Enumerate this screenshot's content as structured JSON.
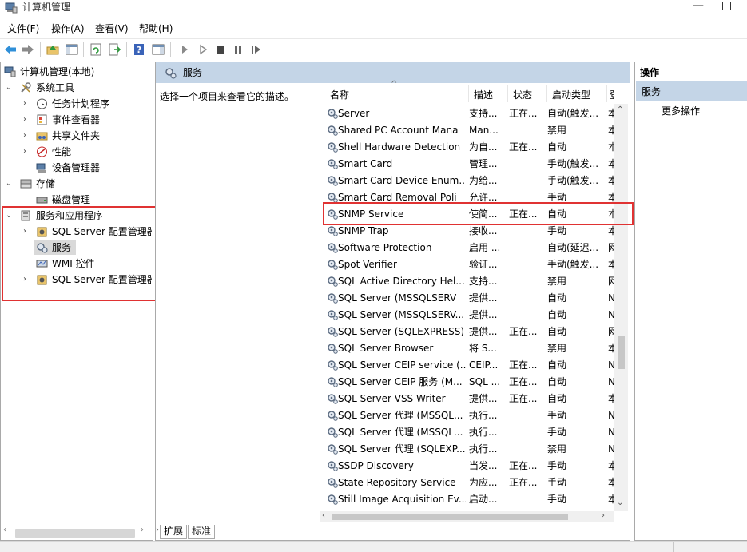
{
  "window": {
    "title": "计算机管理"
  },
  "menu": [
    "文件(F)",
    "操作(A)",
    "查看(V)",
    "帮助(H)"
  ],
  "toolbar_icons": [
    "back-icon",
    "forward-icon",
    "up-folder-icon",
    "show-hide-tree-icon",
    "refresh-icon",
    "export-list-icon",
    "help-icon",
    "show-action-pane-icon",
    "start-service-icon",
    "start-service-alt-icon",
    "stop-service-icon",
    "pause-service-icon",
    "restart-service-icon"
  ],
  "tree": {
    "root": "计算机管理(本地)",
    "system_tools": "系统工具",
    "task_scheduler": "任务计划程序",
    "event_viewer": "事件查看器",
    "shared_folders": "共享文件夹",
    "performance": "性能",
    "device_manager": "设备管理器",
    "storage": "存储",
    "disk_management": "磁盘管理",
    "services_apps": "服务和应用程序",
    "sql_config_1": "SQL Server 配置管理器",
    "services": "服务",
    "wmi": "WMI 控件",
    "sql_config_2": "SQL Server 配置管理器"
  },
  "center": {
    "header_title": "服务",
    "description": "选择一个项目来查看它的描述。",
    "columns": [
      "名称",
      "描述",
      "状态",
      "启动类型",
      "登"
    ],
    "rows": [
      {
        "name": "Server",
        "desc": "支持...",
        "status": "正在...",
        "startup": "自动(触发...",
        "logon": "本"
      },
      {
        "name": "Shared PC Account Mana",
        "desc": "Man...",
        "status": "",
        "startup": "禁用",
        "logon": "本"
      },
      {
        "name": "Shell Hardware Detection",
        "desc": "为自...",
        "status": "正在...",
        "startup": "自动",
        "logon": "本"
      },
      {
        "name": "Smart Card",
        "desc": "管理...",
        "status": "",
        "startup": "手动(触发...",
        "logon": "本"
      },
      {
        "name": "Smart Card Device Enum...",
        "desc": "为给...",
        "status": "",
        "startup": "手动(触发...",
        "logon": "本"
      },
      {
        "name": "Smart Card Removal Poli",
        "desc": "允许...",
        "status": "",
        "startup": "手动",
        "logon": "本"
      },
      {
        "name": "SNMP Service",
        "desc": "使简...",
        "status": "正在...",
        "startup": "自动",
        "logon": "本"
      },
      {
        "name": "SNMP Trap",
        "desc": "接收...",
        "status": "",
        "startup": "手动",
        "logon": "本"
      },
      {
        "name": "Software Protection",
        "desc": "启用 ...",
        "status": "",
        "startup": "自动(延迟...",
        "logon": "网"
      },
      {
        "name": "Spot Verifier",
        "desc": "验证...",
        "status": "",
        "startup": "手动(触发...",
        "logon": "本"
      },
      {
        "name": "SQL Active Directory Hel...",
        "desc": "支持...",
        "status": "",
        "startup": "禁用",
        "logon": "网"
      },
      {
        "name": "SQL Server (MSSQLSERV",
        "desc": "提供...",
        "status": "",
        "startup": "自动",
        "logon": "N"
      },
      {
        "name": "SQL Server (MSSQLSERV...",
        "desc": "提供...",
        "status": "",
        "startup": "自动",
        "logon": "N"
      },
      {
        "name": "SQL Server (SQLEXPRESS)",
        "desc": "提供...",
        "status": "正在...",
        "startup": "自动",
        "logon": "网"
      },
      {
        "name": "SQL Server Browser",
        "desc": "将 S...",
        "status": "",
        "startup": "禁用",
        "logon": "本"
      },
      {
        "name": "SQL Server CEIP service (...",
        "desc": "CEIP...",
        "status": "正在...",
        "startup": "自动",
        "logon": "N"
      },
      {
        "name": "SQL Server CEIP 服务 (M...",
        "desc": "SQL ...",
        "status": "正在...",
        "startup": "自动",
        "logon": "N"
      },
      {
        "name": "SQL Server VSS Writer",
        "desc": "提供...",
        "status": "正在...",
        "startup": "自动",
        "logon": "本"
      },
      {
        "name": "SQL Server 代理 (MSSQL...",
        "desc": "执行...",
        "status": "",
        "startup": "手动",
        "logon": "N"
      },
      {
        "name": "SQL Server 代理 (MSSQL...",
        "desc": "执行...",
        "status": "",
        "startup": "手动",
        "logon": "N"
      },
      {
        "name": "SQL Server 代理 (SQLEXP...",
        "desc": "执行...",
        "status": "",
        "startup": "禁用",
        "logon": "N"
      },
      {
        "name": "SSDP Discovery",
        "desc": "当发...",
        "status": "正在...",
        "startup": "手动",
        "logon": "本"
      },
      {
        "name": "State Repository Service",
        "desc": "为应...",
        "status": "正在...",
        "startup": "手动",
        "logon": "本"
      },
      {
        "name": "Still Image Acquisition Ev...",
        "desc": "启动...",
        "status": "",
        "startup": "手动",
        "logon": "本"
      }
    ]
  },
  "tabs": [
    "扩展",
    "标准"
  ],
  "actions": {
    "title": "操作",
    "section": "服务",
    "more": "更多操作"
  },
  "colors": {
    "accent": "#c4d5e7",
    "highlight_box": "#e03232"
  }
}
